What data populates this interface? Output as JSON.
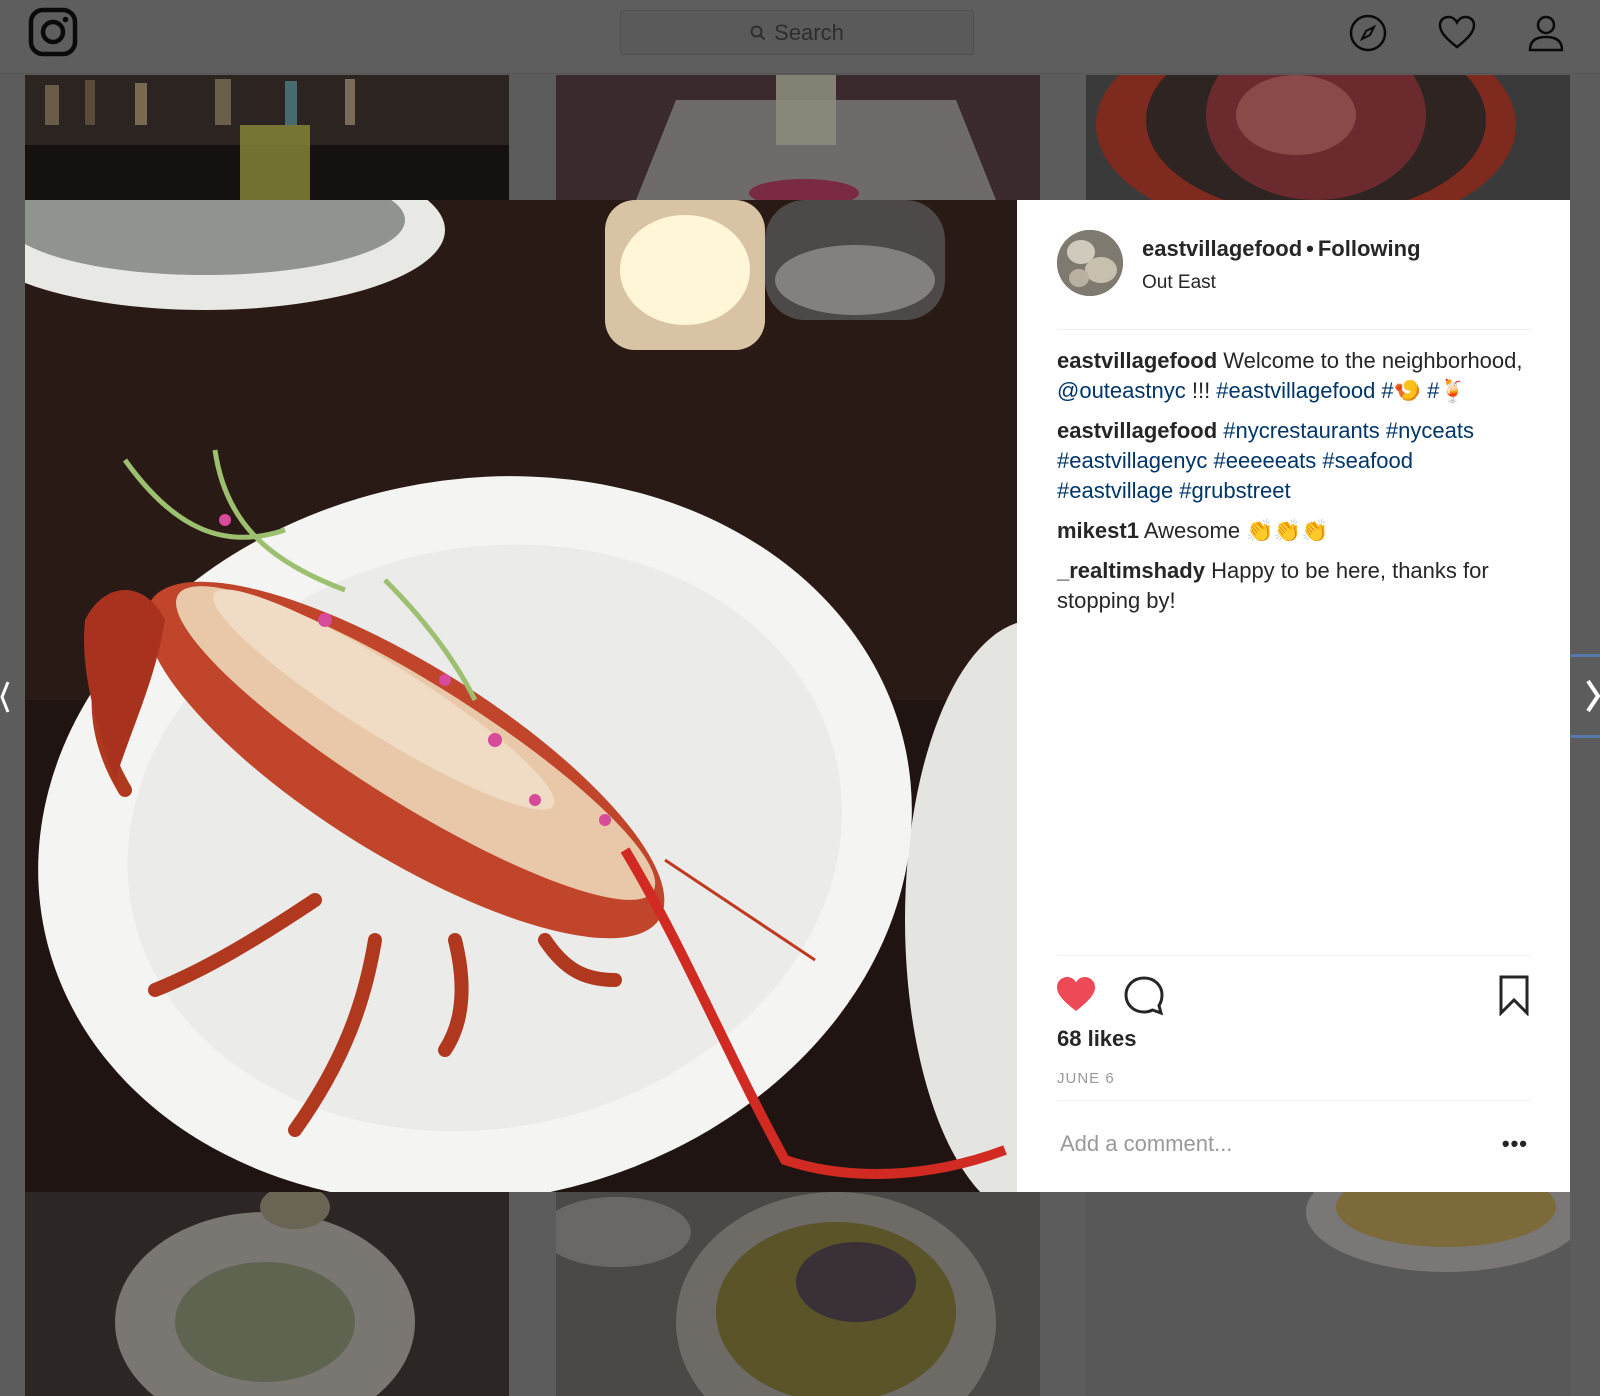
{
  "search": {
    "placeholder": "Search"
  },
  "post": {
    "username": "eastvillagefood",
    "follow_status": "Following",
    "location": "Out East",
    "comments": [
      {
        "user": "eastvillagefood",
        "parts": [
          {
            "text": " Welcome to the neighborhood, ",
            "tag": false
          },
          {
            "text": "@outeastnyc",
            "tag": true
          },
          {
            "text": " !!! ",
            "tag": false
          },
          {
            "text": "#eastvillagefood",
            "tag": true
          },
          {
            "text": " #🍤 #🍹",
            "tag": true
          }
        ]
      },
      {
        "user": "eastvillagefood",
        "parts": [
          {
            "text": " #nycrestaurants #nyceats #eastvillagenyc #eeeeeats #seafood #eastvillage #grubstreet",
            "tag": true
          }
        ]
      },
      {
        "user": "mikest1",
        "parts": [
          {
            "text": " Awesome 👏👏👏",
            "tag": false
          }
        ]
      },
      {
        "user": "_realtimshady",
        "parts": [
          {
            "text": " Happy to be here, thanks for stopping by!",
            "tag": false
          }
        ]
      }
    ],
    "likes_label": "68 likes",
    "date": "JUNE 6",
    "add_comment_placeholder": "Add a comment...",
    "more_label": "•••"
  },
  "colors": {
    "like_red": "#ed4956",
    "link_blue": "#003569",
    "text": "#262626",
    "muted": "#999999"
  },
  "icons": {
    "logo": "instagram-logo-icon",
    "explore": "compass-icon",
    "activity": "heart-icon",
    "profile": "person-icon",
    "like": "heart-filled-icon",
    "comment": "speech-bubble-icon",
    "save": "bookmark-icon",
    "search": "magnifier-icon"
  }
}
